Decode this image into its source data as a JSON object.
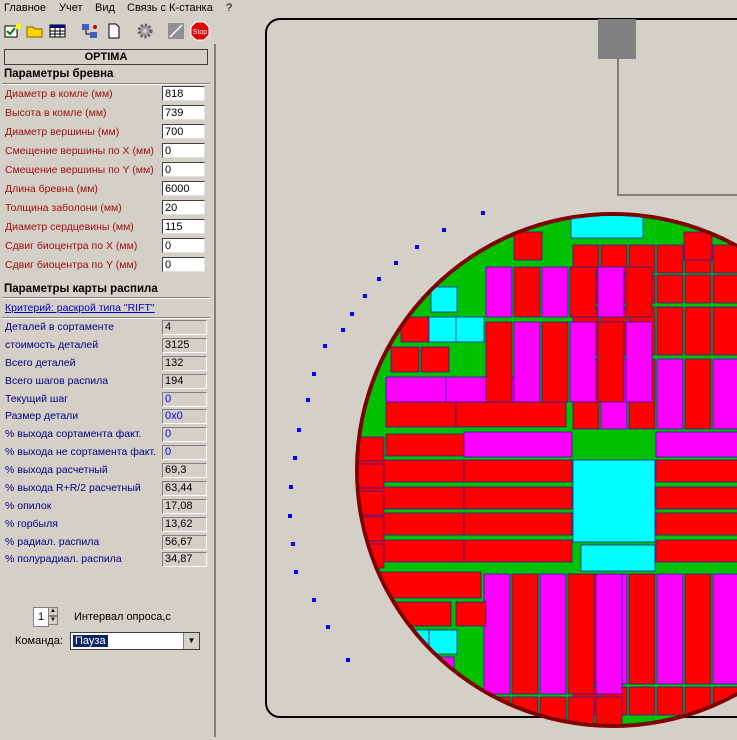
{
  "menu": [
    "Главное",
    "Учет",
    "Вид",
    "Связь с К-станка",
    "?"
  ],
  "toolbar": {
    "icons": [
      "open-select-icon",
      "folder-open-icon",
      "table-icon",
      "network-icon",
      "new-document-icon",
      "gear-icon",
      "line-icon",
      "stop-icon"
    ],
    "stop_label": "Stop"
  },
  "panel_title": "OPTIMA",
  "log_params": {
    "title": "Параметры бревна",
    "rows": [
      {
        "label": "Диаметр в комле (мм)",
        "value": "818"
      },
      {
        "label": "Высота в комле (мм)",
        "value": "739"
      },
      {
        "label": "Диаметр вершины (мм)",
        "value": "700"
      },
      {
        "label": "Смещение вершины по X (мм)",
        "value": "0"
      },
      {
        "label": "Смещение вершины по Y (мм)",
        "value": "0"
      },
      {
        "label": "Длина бревна (мм)",
        "value": "6000"
      },
      {
        "label": "Толщина заболони (мм)",
        "value": "20"
      },
      {
        "label": "Диаметр сердцевины (мм)",
        "value": "115"
      },
      {
        "label": "Сдвиг биоцентра по X (мм)",
        "value": "0"
      },
      {
        "label": "Сдвиг биоцентра по Y (мм)",
        "value": "0"
      }
    ]
  },
  "cut_params": {
    "title": "Параметры карты распила",
    "criterion": "Критерий: раскрой типа \"RIFT\"",
    "rows": [
      {
        "label": "Деталей в сортаменте",
        "value": "4",
        "blue": false
      },
      {
        "label": "стоимость деталей",
        "value": "3125",
        "blue": false
      },
      {
        "label": "Всего деталей",
        "value": "132",
        "blue": false
      },
      {
        "label": "Всего шагов распила",
        "value": "194",
        "blue": false
      },
      {
        "label": "Текущий шаг",
        "value": "0",
        "blue": true
      },
      {
        "label": "Размер детали",
        "value": "0x0",
        "blue": true
      },
      {
        "label": "% выхода сортамента факт.",
        "value": "0",
        "blue": true
      },
      {
        "label": "% выхода не сортамента факт.",
        "value": "0",
        "blue": true
      },
      {
        "label": "% выхода расчетный",
        "value": "69,3",
        "blue": false
      },
      {
        "label": "% выхода R+R/2 расчетный",
        "value": "63,44",
        "blue": false
      },
      {
        "label": "% опилок",
        "value": "17,08",
        "blue": false
      },
      {
        "label": "% горбыля",
        "value": "13,62",
        "blue": false
      },
      {
        "label": "% радиал. распила",
        "value": "56,67",
        "blue": false
      },
      {
        "label": "% полурадиал. распила",
        "value": "34,87",
        "blue": false
      }
    ]
  },
  "poll": {
    "value": "1",
    "label": "Интервал опроса,с"
  },
  "command": {
    "label": "Команда:",
    "value": "Пауза"
  },
  "colors": {
    "bark": "#800000",
    "sapwood": "#ffff40",
    "board_red": "#ff0000",
    "board_magenta": "#ff00ff",
    "board_cyan": "#00ffff",
    "green": "#00c000",
    "points": "#0000ff"
  }
}
